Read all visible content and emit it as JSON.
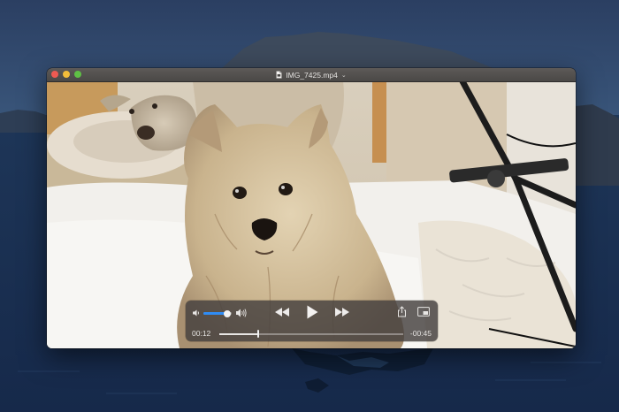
{
  "window": {
    "title": "IMG_7425.mp4",
    "title_chevron": "⌄",
    "file_icon": "document-icon",
    "traffic_lights": {
      "close": "#ee5a52",
      "minimize": "#f4bd3a",
      "zoom": "#5fc145"
    }
  },
  "player": {
    "time_elapsed": "00:12",
    "time_remaining": "-00:45",
    "progress_fraction": 0.21,
    "volume_fraction": 0.85,
    "accent_color": "#2f8cf5",
    "icons": {
      "volume_low": "speaker-low-icon",
      "volume_high": "speaker-high-icon",
      "rewind": "rewind-icon",
      "play": "play-icon",
      "fast_forward": "fast-forward-icon",
      "share": "share-icon",
      "picture_in_picture": "picture-in-picture-icon"
    }
  }
}
